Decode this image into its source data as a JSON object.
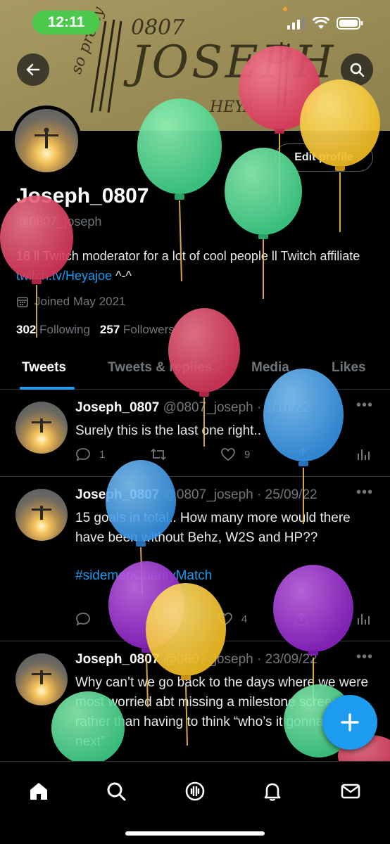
{
  "status_bar": {
    "time": "12:11"
  },
  "banner": {
    "scribbles": [
      "0807",
      "JOSEPH",
      "so pretty",
      "HEYA"
    ]
  },
  "header": {
    "back_icon": "arrow-left-icon",
    "search_icon": "search-icon"
  },
  "profile": {
    "edit_label": "Edit profile",
    "display_name": "Joseph_0807",
    "handle": "@0807_joseph",
    "bio_text": "18 ll Twitch moderator for a lot of cool people ll Twitch affiliate ",
    "bio_link": "twitch.tv/Heyajoe",
    "bio_suffix": " ^-^",
    "joined": "Joined May 2021",
    "following_count": "302",
    "following_label": "Following",
    "followers_count": "257",
    "followers_label": "Followers"
  },
  "tabs": [
    "Tweets",
    "Tweets & replies",
    "Media",
    "Likes"
  ],
  "tweets": [
    {
      "name": "Joseph_0807",
      "meta": " @0807_joseph · 1/10/22",
      "text": "Surely this is the last one right..",
      "hashtag": "",
      "replies": "1",
      "retweets": "",
      "likes": "9"
    },
    {
      "name": "Joseph_0807",
      "meta": " @0807_joseph · 25/09/22",
      "text": "15 goals in total.. How many more would there have been without Behz, W2S and HP??",
      "hashtag": "#sidemenCharityMatch",
      "replies": "",
      "retweets": "",
      "likes": "4"
    },
    {
      "name": "Joseph_0807",
      "meta": " @0807_joseph · 23/09/22",
      "text": "Why can’t we go back to the days where we were most worried abt missing a milestone screenie rather than having to think “who’s it gonna be next”",
      "hashtag": "",
      "replies": "",
      "retweets": "",
      "likes": ""
    }
  ],
  "nav": [
    "home-icon",
    "search-icon",
    "spaces-icon",
    "notifications-icon",
    "messages-icon"
  ],
  "colors": {
    "accent": "#1d9bf0",
    "background": "#000000",
    "muted": "#71767b",
    "clock_pill": "#4cc94c"
  }
}
